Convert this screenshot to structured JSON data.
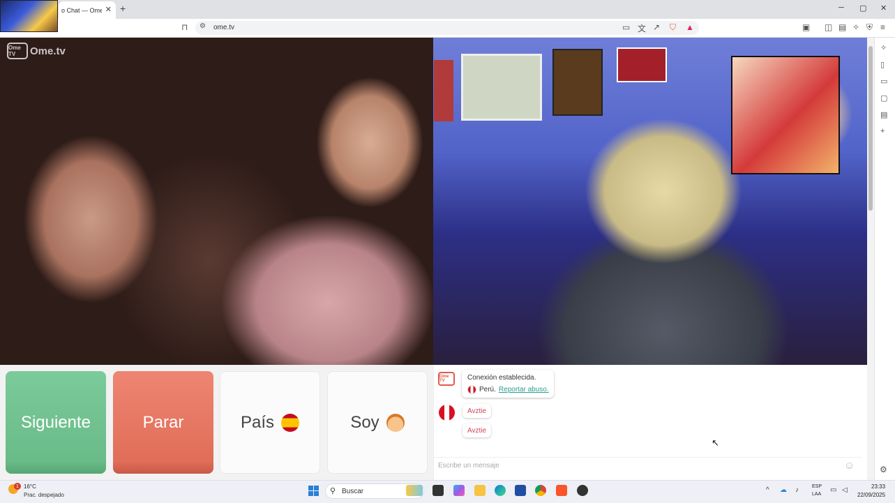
{
  "browser": {
    "tab_title": "o Chat — Omeg",
    "tab_close": "✕",
    "new_tab": "+",
    "url": "ome.tv",
    "window_controls": [
      "─",
      "▢",
      "✕"
    ]
  },
  "page": {
    "logo_box": "Ome TV",
    "logo_text": "Ome.tv",
    "buttons": {
      "next": "Siguiente",
      "stop": "Parar",
      "country": "País",
      "iam": "Soy"
    },
    "chat": {
      "chat_logo": "Ome TV",
      "system_line1": "Conexión establecida.",
      "system_country": "Perú.",
      "report_link": "Reportar abuso.",
      "messages": [
        "Avztie",
        "Avztie"
      ],
      "input_placeholder": "Escribe un mensaje",
      "emoji": "☺"
    }
  },
  "taskbar": {
    "temperature": "16°C",
    "weather_badge": "1",
    "condition": "Prac. despejado",
    "search_label": "Buscar",
    "lang_line1": "ESP",
    "lang_line2": "LAA",
    "time": "23:33",
    "date": "22/09/2025"
  },
  "colors": {
    "next_button": "#69bb88",
    "stop_button": "#e06e58",
    "report_link": "#2a9d8f",
    "chat_message": "#d0445a"
  }
}
